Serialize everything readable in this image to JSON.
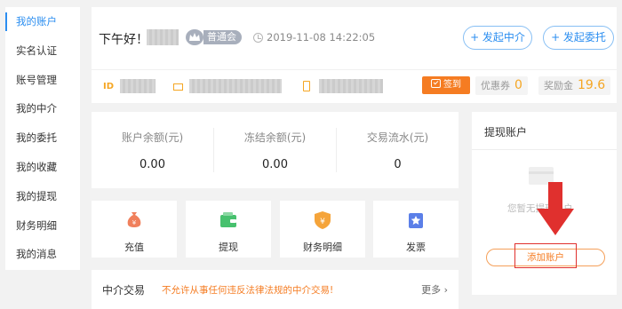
{
  "sidebar": {
    "items": [
      {
        "label": "我的账户",
        "active": true
      },
      {
        "label": "实名认证"
      },
      {
        "label": "账号管理"
      },
      {
        "label": "我的中介"
      },
      {
        "label": "我的委托"
      },
      {
        "label": "我的收藏"
      },
      {
        "label": "我的提现"
      },
      {
        "label": "财务明细"
      },
      {
        "label": "我的消息"
      }
    ]
  },
  "profile": {
    "greeting": "下午好！",
    "member_level": "普通会",
    "datetime": "2019-11-08 14:22:05",
    "id_label": "ID",
    "checkin_label": "签到",
    "coupon_label": "优惠券",
    "coupon_count": "0",
    "reward_label": "奖励金",
    "reward_amount": "19.6"
  },
  "actions": {
    "start_agent": "+ 发起中介",
    "start_commission": "+ 发起委托"
  },
  "balances": [
    {
      "label": "账户余额(元)",
      "value": "0.00"
    },
    {
      "label": "冻结余额(元)",
      "value": "0.00"
    },
    {
      "label": "交易流水(元)",
      "value": "0"
    }
  ],
  "tiles": [
    {
      "label": "充值",
      "icon": "money-bag-icon",
      "color": "#f0805c"
    },
    {
      "label": "提现",
      "icon": "wallet-icon",
      "color": "#47c16e"
    },
    {
      "label": "财务明细",
      "icon": "shield-yuan-icon",
      "color": "#f5a43a"
    },
    {
      "label": "发票",
      "icon": "invoice-star-icon",
      "color": "#5b7fe8"
    }
  ],
  "agent_trade": {
    "title": "中介交易",
    "warning": "不允许从事任何违反法律法规的中介交易!",
    "more": "更多 ›"
  },
  "withdraw": {
    "title": "提现账户",
    "empty_text": "您暂无提现账户",
    "add_button": "添加账户"
  },
  "colors": {
    "accent": "#2b8ef0",
    "orange": "#f57c22",
    "annotation": "#e0302e"
  }
}
